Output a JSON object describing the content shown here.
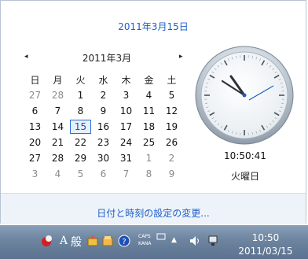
{
  "flyout": {
    "date_link": "2011年3月15日",
    "month_title": "2011年3月",
    "prev_icon": "◂",
    "next_icon": "▸",
    "weekdays": [
      "日",
      "月",
      "火",
      "水",
      "木",
      "金",
      "土"
    ],
    "weeks": [
      [
        {
          "d": "27",
          "o": true
        },
        {
          "d": "28",
          "o": true
        },
        {
          "d": "1"
        },
        {
          "d": "2"
        },
        {
          "d": "3"
        },
        {
          "d": "4"
        },
        {
          "d": "5"
        }
      ],
      [
        {
          "d": "6"
        },
        {
          "d": "7"
        },
        {
          "d": "8"
        },
        {
          "d": "9"
        },
        {
          "d": "10"
        },
        {
          "d": "11"
        },
        {
          "d": "12"
        }
      ],
      [
        {
          "d": "13"
        },
        {
          "d": "14"
        },
        {
          "d": "15",
          "today": true
        },
        {
          "d": "16"
        },
        {
          "d": "17"
        },
        {
          "d": "18"
        },
        {
          "d": "19"
        }
      ],
      [
        {
          "d": "20"
        },
        {
          "d": "21"
        },
        {
          "d": "22"
        },
        {
          "d": "23"
        },
        {
          "d": "24"
        },
        {
          "d": "25"
        },
        {
          "d": "26"
        }
      ],
      [
        {
          "d": "27"
        },
        {
          "d": "28"
        },
        {
          "d": "29"
        },
        {
          "d": "30"
        },
        {
          "d": "31"
        },
        {
          "d": "1",
          "o": true
        },
        {
          "d": "2",
          "o": true
        }
      ],
      [
        {
          "d": "3",
          "o": true
        },
        {
          "d": "4",
          "o": true
        },
        {
          "d": "5",
          "o": true
        },
        {
          "d": "6",
          "o": true
        },
        {
          "d": "7",
          "o": true
        },
        {
          "d": "8",
          "o": true
        },
        {
          "d": "9",
          "o": true
        }
      ]
    ],
    "clock_time": "10:50:41",
    "day_of_week": "火曜日",
    "settings_link": "日付と時刻の設定の変更..."
  },
  "taskbar": {
    "ime_a": "A",
    "ime_mode": "般",
    "caps_line1": "CAPS",
    "caps_line2": "KANA",
    "show_hidden_icon": "▲",
    "time": "10:50",
    "date": "2011/03/15"
  },
  "colors": {
    "link": "#1c5ec7",
    "today_border": "#2b6ccf",
    "taskbar": "#6f86a1"
  }
}
